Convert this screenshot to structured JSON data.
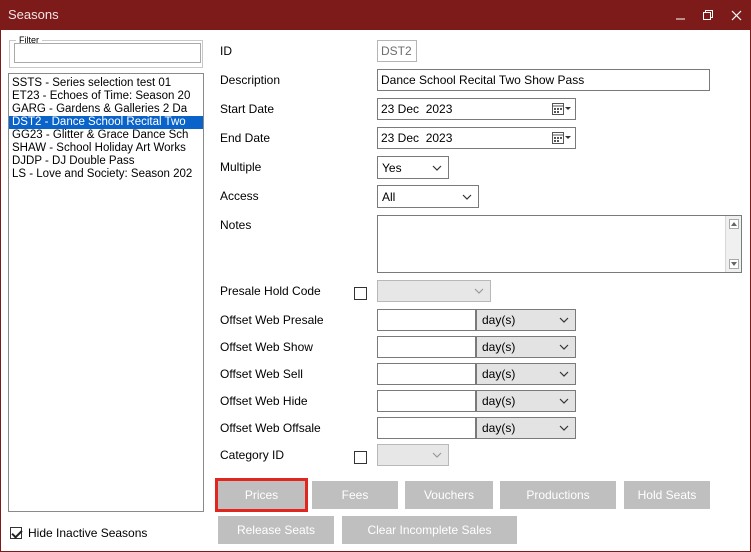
{
  "window": {
    "title": "Seasons"
  },
  "filter": {
    "legend": "Filter",
    "value": ""
  },
  "seasons": [
    {
      "label": "SSTS - Series selection test 01",
      "selected": false
    },
    {
      "label": "ET23 - Echoes of Time: Season 20",
      "selected": false
    },
    {
      "label": "GARG - Gardens & Galleries 2 Da",
      "selected": false
    },
    {
      "label": "DST2 - Dance School Recital Two",
      "selected": true
    },
    {
      "label": "GG23 - Glitter & Grace Dance Sch",
      "selected": false
    },
    {
      "label": "SHAW - School Holiday Art Works",
      "selected": false
    },
    {
      "label": "DJDP - DJ Double Pass",
      "selected": false
    },
    {
      "label": "LS - Love and Society: Season 202",
      "selected": false
    }
  ],
  "hide_inactive": {
    "label": "Hide Inactive Seasons",
    "checked": true
  },
  "form": {
    "id_label": "ID",
    "id_value": "DST2",
    "description_label": "Description",
    "description_value": "Dance School Recital Two Show Pass",
    "start_label": "Start Date",
    "start_value": "23 Dec  2023",
    "end_label": "End Date",
    "end_value": "23 Dec  2023",
    "multiple_label": "Multiple",
    "multiple_value": "Yes",
    "access_label": "Access",
    "access_value": "All",
    "notes_label": "Notes",
    "notes_value": "",
    "presale_label": "Presale Hold Code",
    "offset_presale_label": "Offset Web Presale",
    "offset_show_label": "Offset Web Show",
    "offset_sell_label": "Offset Web Sell",
    "offset_hide_label": "Offset Web Hide",
    "offset_offsale_label": "Offset Web Offsale",
    "unit": "day(s)",
    "category_label": "Category ID"
  },
  "buttons": {
    "prices": "Prices",
    "fees": "Fees",
    "vouchers": "Vouchers",
    "productions": "Productions",
    "hold_seats": "Hold Seats",
    "release_seats": "Release Seats",
    "clear_incomplete": "Clear Incomplete Sales"
  },
  "colors": {
    "titlebar": "#7d1b1b",
    "selection": "#0a63c9",
    "button": "#bfbfbf",
    "highlight": "#e0261e"
  }
}
